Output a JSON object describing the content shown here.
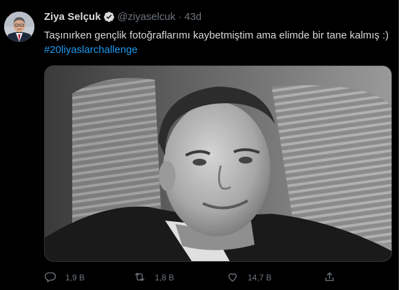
{
  "tweet": {
    "author_name": "Ziya Selçuk",
    "handle": "@ziyaselcuk",
    "separator": "·",
    "time": "43d",
    "text": "Taşınırken gençlik fotoğraflarımı kaybetmiştim ama elimde bir tane kalmış :)",
    "hashtag": "#20liyaslarchallenge"
  },
  "actions": {
    "reply_count": "1,9 B",
    "retweet_count": "1,8 B",
    "like_count": "14,7 B"
  },
  "colors": {
    "background": "#000000",
    "text": "#d9d9d9",
    "secondary": "#6e767d",
    "link": "#1d9bf0",
    "verified": "#d9d9d9"
  },
  "icons": [
    "verified-badge-icon",
    "reply-icon",
    "retweet-icon",
    "like-icon",
    "share-icon"
  ]
}
